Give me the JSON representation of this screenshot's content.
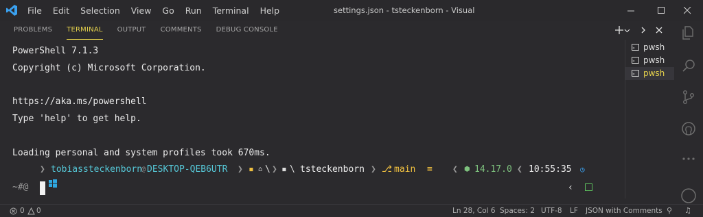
{
  "titlebar": {
    "menu": [
      "File",
      "Edit",
      "Selection",
      "View",
      "Go",
      "Run",
      "Terminal",
      "Help"
    ],
    "title": "settings.json - tsteckenborn - Visual"
  },
  "panel": {
    "tabs": [
      "PROBLEMS",
      "TERMINAL",
      "OUTPUT",
      "COMMENTS",
      "DEBUG CONSOLE"
    ],
    "active_tab": "TERMINAL"
  },
  "terminal": {
    "lines": [
      "PowerShell 7.1.3",
      "Copyright (c) Microsoft Corporation.",
      "",
      "https://aka.ms/powershell",
      "Type 'help' to get help.",
      "",
      "Loading personal and system profiles took 670ms."
    ],
    "prompt": {
      "user": "tobiassteckenborn",
      "at": "@",
      "host": "DESKTOP-QEB6UTR",
      "home_sep": "\\",
      "dir": "tsteckenborn",
      "branch": "main",
      "node_version": "14.17.0",
      "time": "10:55:35"
    },
    "input_prefix": "~#@"
  },
  "terminal_list": [
    {
      "label": "pwsh",
      "selected": false
    },
    {
      "label": "pwsh",
      "selected": false
    },
    {
      "label": "pwsh",
      "selected": true
    }
  ],
  "statusbar": {
    "errors": "0",
    "warnings": "0",
    "position": "Ln 28, Col 6",
    "spaces": "Spaces: 2",
    "encoding": "UTF-8",
    "eol": "LF",
    "language": "JSON with Comments"
  },
  "colors": {
    "accent_yellow": "#e8d44d",
    "prompt_cyan": "#56c8d8",
    "prompt_green": "#7ec27e"
  }
}
